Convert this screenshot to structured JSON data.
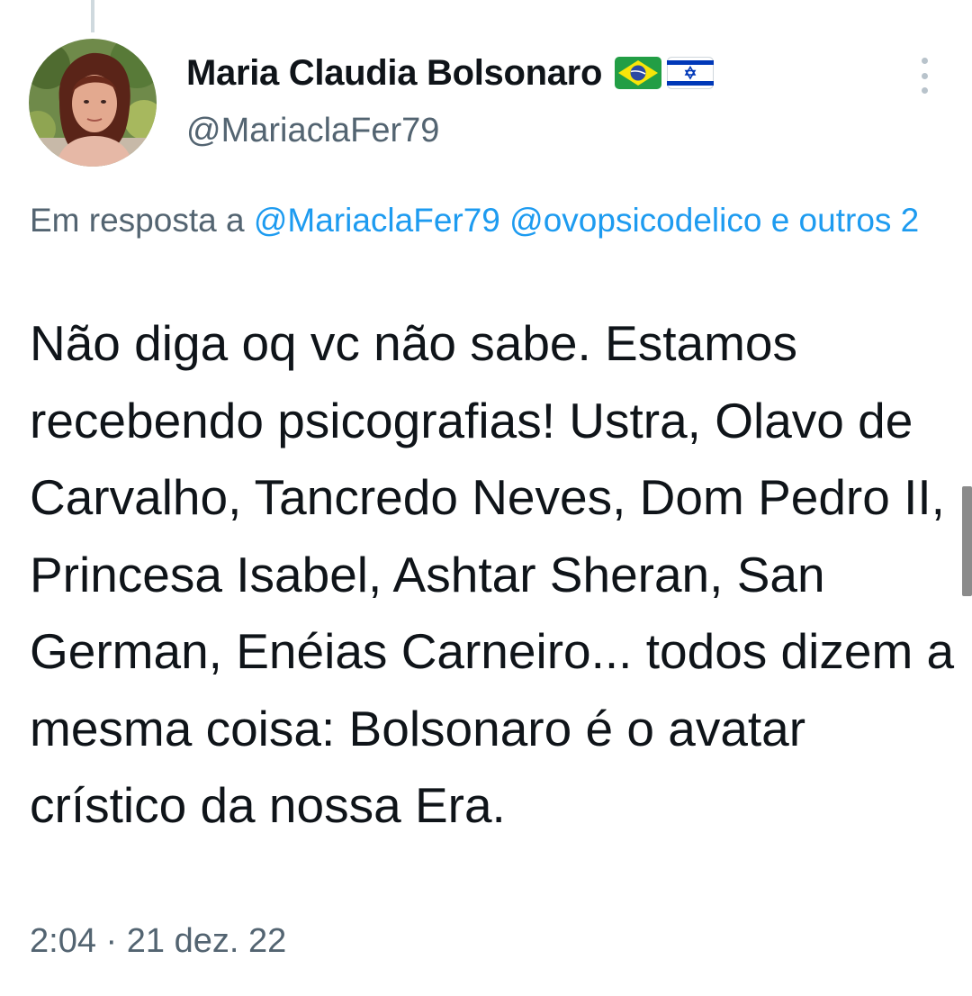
{
  "tweet": {
    "author": {
      "display_name": "Maria Claudia Bolsonaro",
      "handle": "@MariaclaFer79",
      "flags": [
        "brazil-flag-icon",
        "israel-flag-icon"
      ]
    },
    "reply_context": {
      "prefix": "Em resposta a ",
      "mentions": [
        "@MariaclaFer79",
        "@ovopsicodelico"
      ],
      "others": "e outros 2"
    },
    "text": "Não diga oq vc não sabe. Estamos recebendo psicografias! Ustra, Olavo de Carvalho, Tancredo Neves, Dom Pedro II, Princesa Isabel, Ashtar Sheran, San German, Enéias Carneiro... todos dizem a mesma coisa: Bolsonaro é o avatar crístico da nossa Era.",
    "time": "2:04",
    "separator": " · ",
    "date": "21 dez. 22"
  },
  "colors": {
    "text_primary": "#0f1419",
    "text_secondary": "#536471",
    "link": "#1d9bf0"
  }
}
